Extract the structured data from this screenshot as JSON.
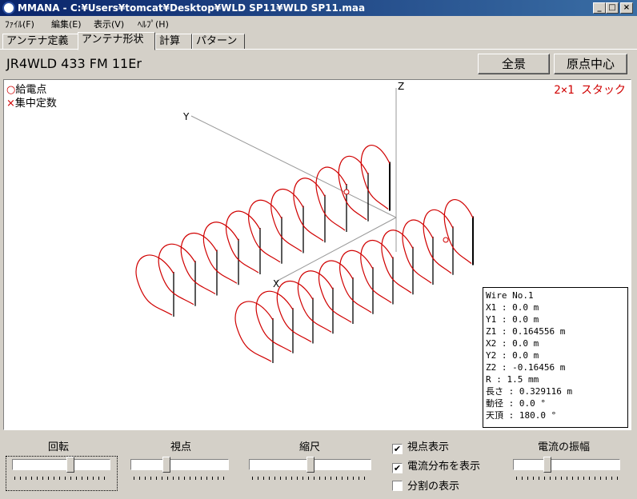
{
  "window": {
    "title": "MMANA - C:¥Users¥tomcat¥Desktop¥WLD SP11¥WLD SP11.maa",
    "minimize": "_",
    "maximize": "□",
    "close": "×"
  },
  "menu": [
    "ﾌｧｲﾙ(F)",
    "編集(E)",
    "表示(V)",
    "ﾍﾙﾌﾟ(H)"
  ],
  "tabs": [
    {
      "label": "アンテナ定義",
      "active": false
    },
    {
      "label": "アンテナ形状",
      "active": true
    },
    {
      "label": "計算",
      "active": false
    },
    {
      "label": "パターン",
      "active": false
    }
  ],
  "antenna_name": "JR4WLD 433 FM 11Er",
  "buttons": {
    "full_view": "全景",
    "origin_center": "原点中心"
  },
  "viewport": {
    "legend_feed": "給電点",
    "legend_feed_marker": "○",
    "legend_load": "集中定数",
    "legend_load_marker": "×",
    "stack_label": "2×1 スタック",
    "axis_x": "X",
    "axis_y": "Y",
    "axis_z": "Z",
    "current_color": "#d00000"
  },
  "wire_info": [
    "Wire No.1",
    "X1   : 0.0 m",
    "Y1   : 0.0 m",
    "Z1   : 0.164556 m",
    "X2   : 0.0 m",
    "Y2   : 0.0 m",
    "Z2   : -0.16456 m",
    "R    : 1.5 mm",
    "長さ : 0.329116 m",
    "動径 : 0.0 °",
    "天頂 : 180.0 °"
  ],
  "controls": {
    "rotation": {
      "label": "回転",
      "level": 0.6
    },
    "viewpoint": {
      "label": "視点",
      "level": 0.35
    },
    "scale": {
      "label": "縮尺",
      "level": 0.5
    },
    "current_amplitude": {
      "label": "電流の振幅",
      "level": 0.3
    }
  },
  "checkboxes": [
    {
      "label": "視点表示",
      "checked": true,
      "mark": "✔"
    },
    {
      "label": "電流分布を表示",
      "checked": true,
      "mark": "✔"
    },
    {
      "label": "分割の表示",
      "checked": false,
      "mark": ""
    }
  ]
}
